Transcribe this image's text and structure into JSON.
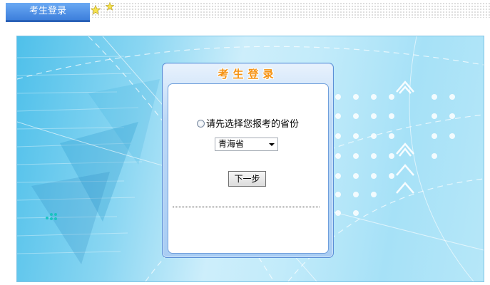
{
  "header": {
    "tab_label": "考生登录",
    "icons": [
      "star-icon",
      "star-icon"
    ]
  },
  "login_panel": {
    "title": "考生登录",
    "prompt": "请先选择您报考的省份",
    "province_select": {
      "selected": "青海省"
    },
    "next_button": "下一步"
  },
  "colors": {
    "tab_blue": "#3d7fdc",
    "title_orange": "#f59212",
    "banner_blue": "#4fc0ea"
  }
}
